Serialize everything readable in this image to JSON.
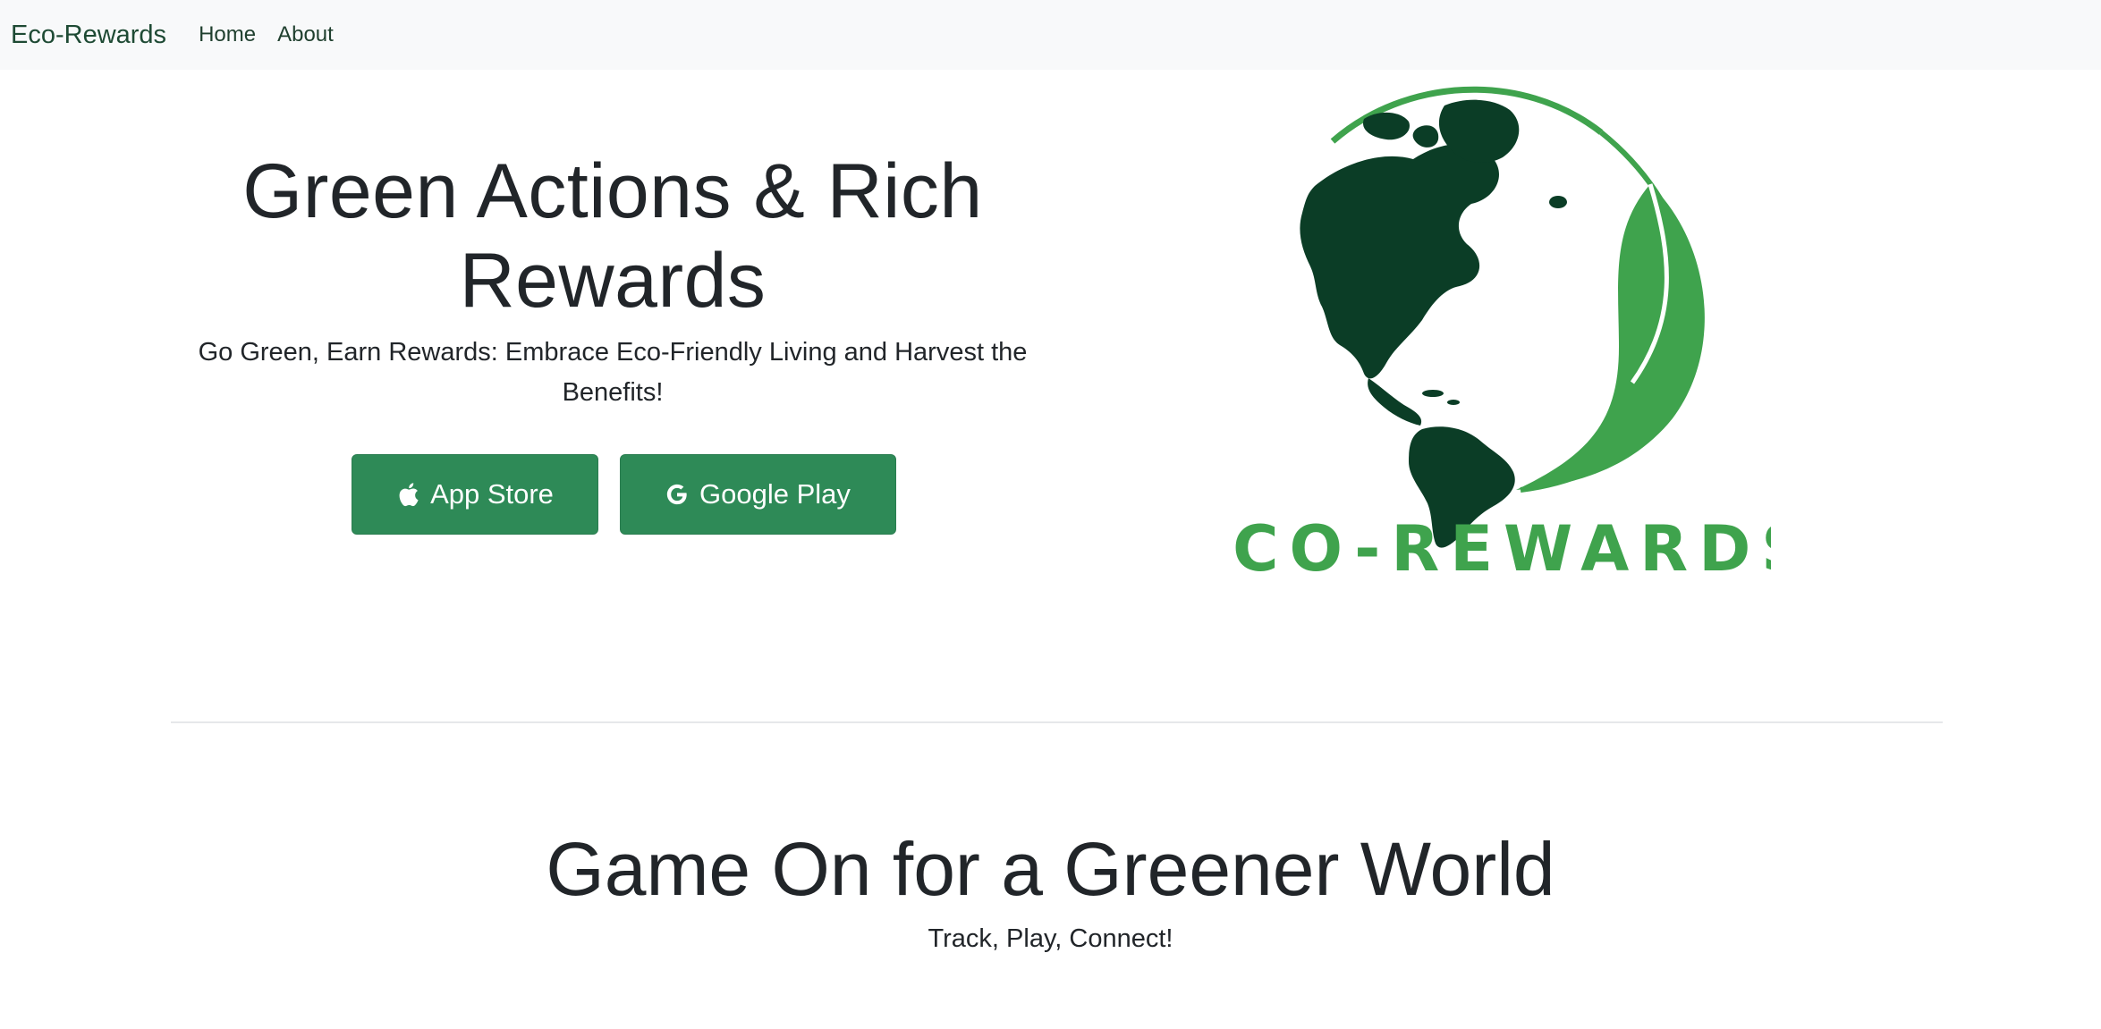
{
  "nav": {
    "brand": "Eco-Rewards",
    "links": [
      "Home",
      "About"
    ]
  },
  "hero": {
    "title": "Green Actions & Rich Rewards",
    "subtitle": "Go Green, Earn Rewards: Embrace Eco-Friendly Living and Harvest the Benefits!",
    "buttons": {
      "app_store": "App Store",
      "google_play": "Google Play"
    }
  },
  "logo": {
    "text": "ECO-REWARDS",
    "icon": "globe-with-leaf-icon"
  },
  "section": {
    "title": "Game On for a Greener World",
    "subtitle": "Track, Play, Connect!"
  },
  "colors": {
    "primary": "#2e8a57",
    "dark_green": "#0b3d26",
    "light_green": "#3fa34d",
    "navbar_bg": "#f8f9fa"
  }
}
